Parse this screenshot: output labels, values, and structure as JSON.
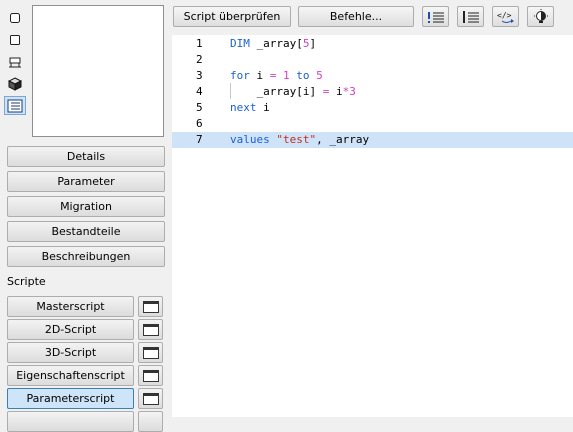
{
  "side_icons": [
    "square-rounded-icon",
    "square-icon",
    "table-icon",
    "cube-icon",
    "list-icon"
  ],
  "buttons": {
    "details": "Details",
    "parameter": "Parameter",
    "migration": "Migration",
    "bestandteile": "Bestandteile",
    "beschreibungen": "Beschreibungen"
  },
  "scripts": {
    "label": "Scripte",
    "items": [
      "Masterscript",
      "2D-Script",
      "3D-Script",
      "Eigenschaftenscript",
      "Parameterscript"
    ],
    "selected": "Parameterscript"
  },
  "toolbar": {
    "check_script": "Script überprüfen",
    "commands": "Befehle...",
    "icons": [
      "format-icon",
      "list-format-icon",
      "code-tag-icon",
      "light-bulb-icon"
    ]
  },
  "editor": {
    "line_numbers": [
      "1",
      "2",
      "3",
      "4",
      "5",
      "6",
      "7"
    ],
    "lines": [
      [
        [
          "kw",
          "DIM"
        ],
        [
          "plain",
          " _array["
        ],
        [
          "num",
          "5"
        ],
        [
          "plain",
          "]"
        ]
      ],
      [],
      [
        [
          "kw",
          "for"
        ],
        [
          "plain",
          " i "
        ],
        [
          "op",
          "="
        ],
        [
          "plain",
          " "
        ],
        [
          "num",
          "1"
        ],
        [
          "plain",
          " "
        ],
        [
          "kw",
          "to"
        ],
        [
          "plain",
          " "
        ],
        [
          "num",
          "5"
        ]
      ],
      [
        [
          "plain",
          "    _array[i] "
        ],
        [
          "op",
          "="
        ],
        [
          "plain",
          " i"
        ],
        [
          "op",
          "*"
        ],
        [
          "num",
          "3"
        ]
      ],
      [
        [
          "kw",
          "next"
        ],
        [
          "plain",
          " i"
        ]
      ],
      [],
      [
        [
          "kw",
          "values"
        ],
        [
          "plain",
          " "
        ],
        [
          "str",
          "\"test\""
        ],
        [
          "plain",
          ", _array"
        ]
      ]
    ],
    "highlighted_line": 7,
    "colors": {
      "keyword": "#1a5fd6",
      "number": "#d03fbf",
      "string": "#c0301c",
      "highlight": "#cfe3f8"
    }
  }
}
